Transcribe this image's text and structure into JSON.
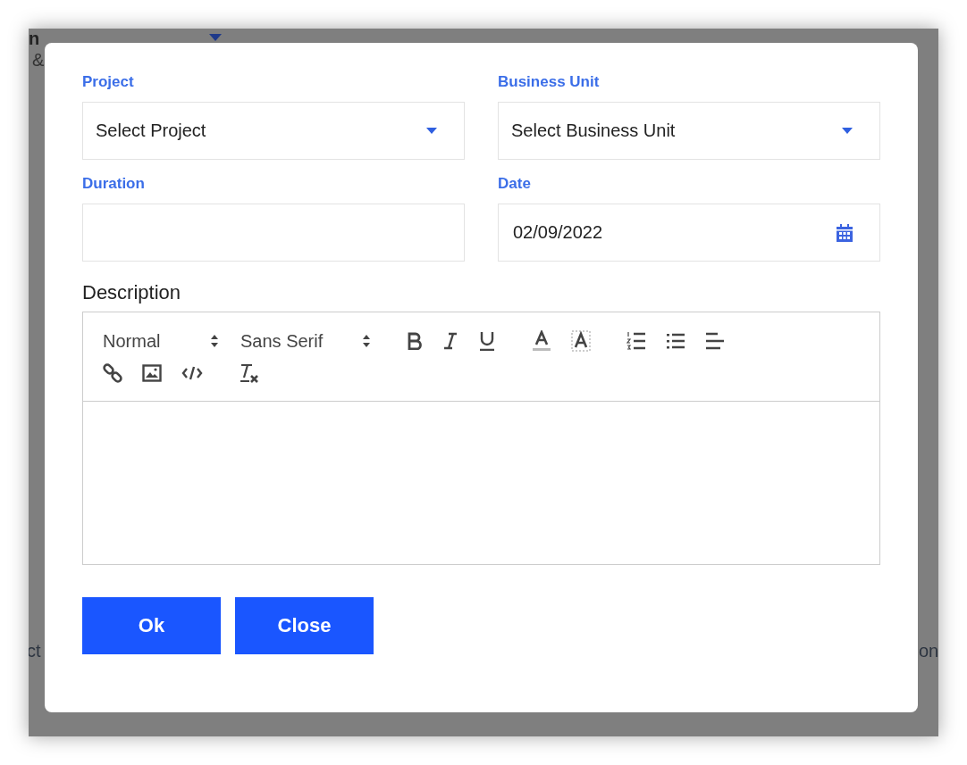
{
  "background": {
    "top_title": "n",
    "top_subtitle": "&",
    "bottom_left": "ct",
    "bottom_right": "on"
  },
  "dialog": {
    "fields": [
      {
        "label": "Project",
        "kind": "select",
        "value": "Select Project"
      },
      {
        "label": "Business Unit",
        "kind": "select",
        "value": "Select Business Unit"
      },
      {
        "label": "Duration",
        "kind": "text"
      },
      {
        "label": "Date",
        "kind": "date",
        "value": "02/09/2022"
      }
    ],
    "description": {
      "label": "Description",
      "pickers": [
        "Normal",
        "Sans Serif"
      ]
    },
    "buttons": [
      "Ok",
      "Close"
    ]
  }
}
